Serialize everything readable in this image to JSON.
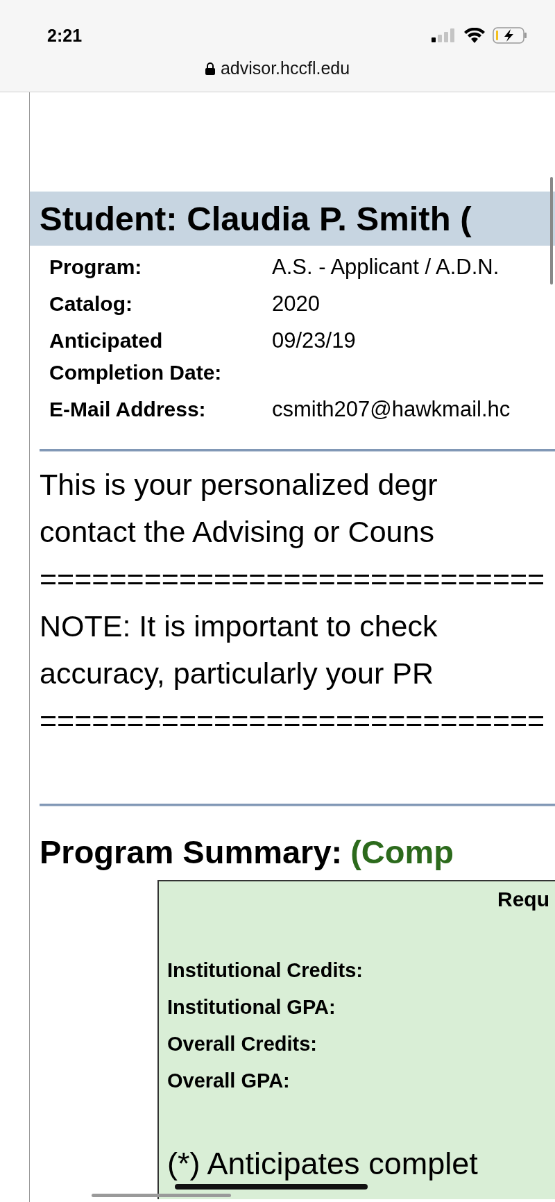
{
  "status_bar": {
    "time": "2:21"
  },
  "address_bar": {
    "url": "advisor.hccfl.edu"
  },
  "student": {
    "title": "Student: Claudia P. Smith (",
    "fields": [
      {
        "label": "Program:",
        "value": "A.S. - Applicant / A.D.N. "
      },
      {
        "label": "Catalog:",
        "value": "2020"
      },
      {
        "label": "Anticipated Completion Date:",
        "value": "09/23/19"
      },
      {
        "label": "E-Mail Address:",
        "value": "csmith207@hawkmail.hc"
      }
    ]
  },
  "intro_lines": [
    "This is your personalized degr",
    "contact the Advising or Couns",
    "=============================",
    "NOTE: It is important to check",
    "accuracy, particularly your PR",
    "============================="
  ],
  "program_summary": {
    "title": "Program Summary:",
    "status": "(Comp",
    "column_heading": "Requ",
    "rows": [
      "Institutional Credits:",
      "Institutional GPA:",
      "Overall Credits:",
      "Overall GPA:"
    ],
    "footnote": "(*) Anticipates complet"
  }
}
